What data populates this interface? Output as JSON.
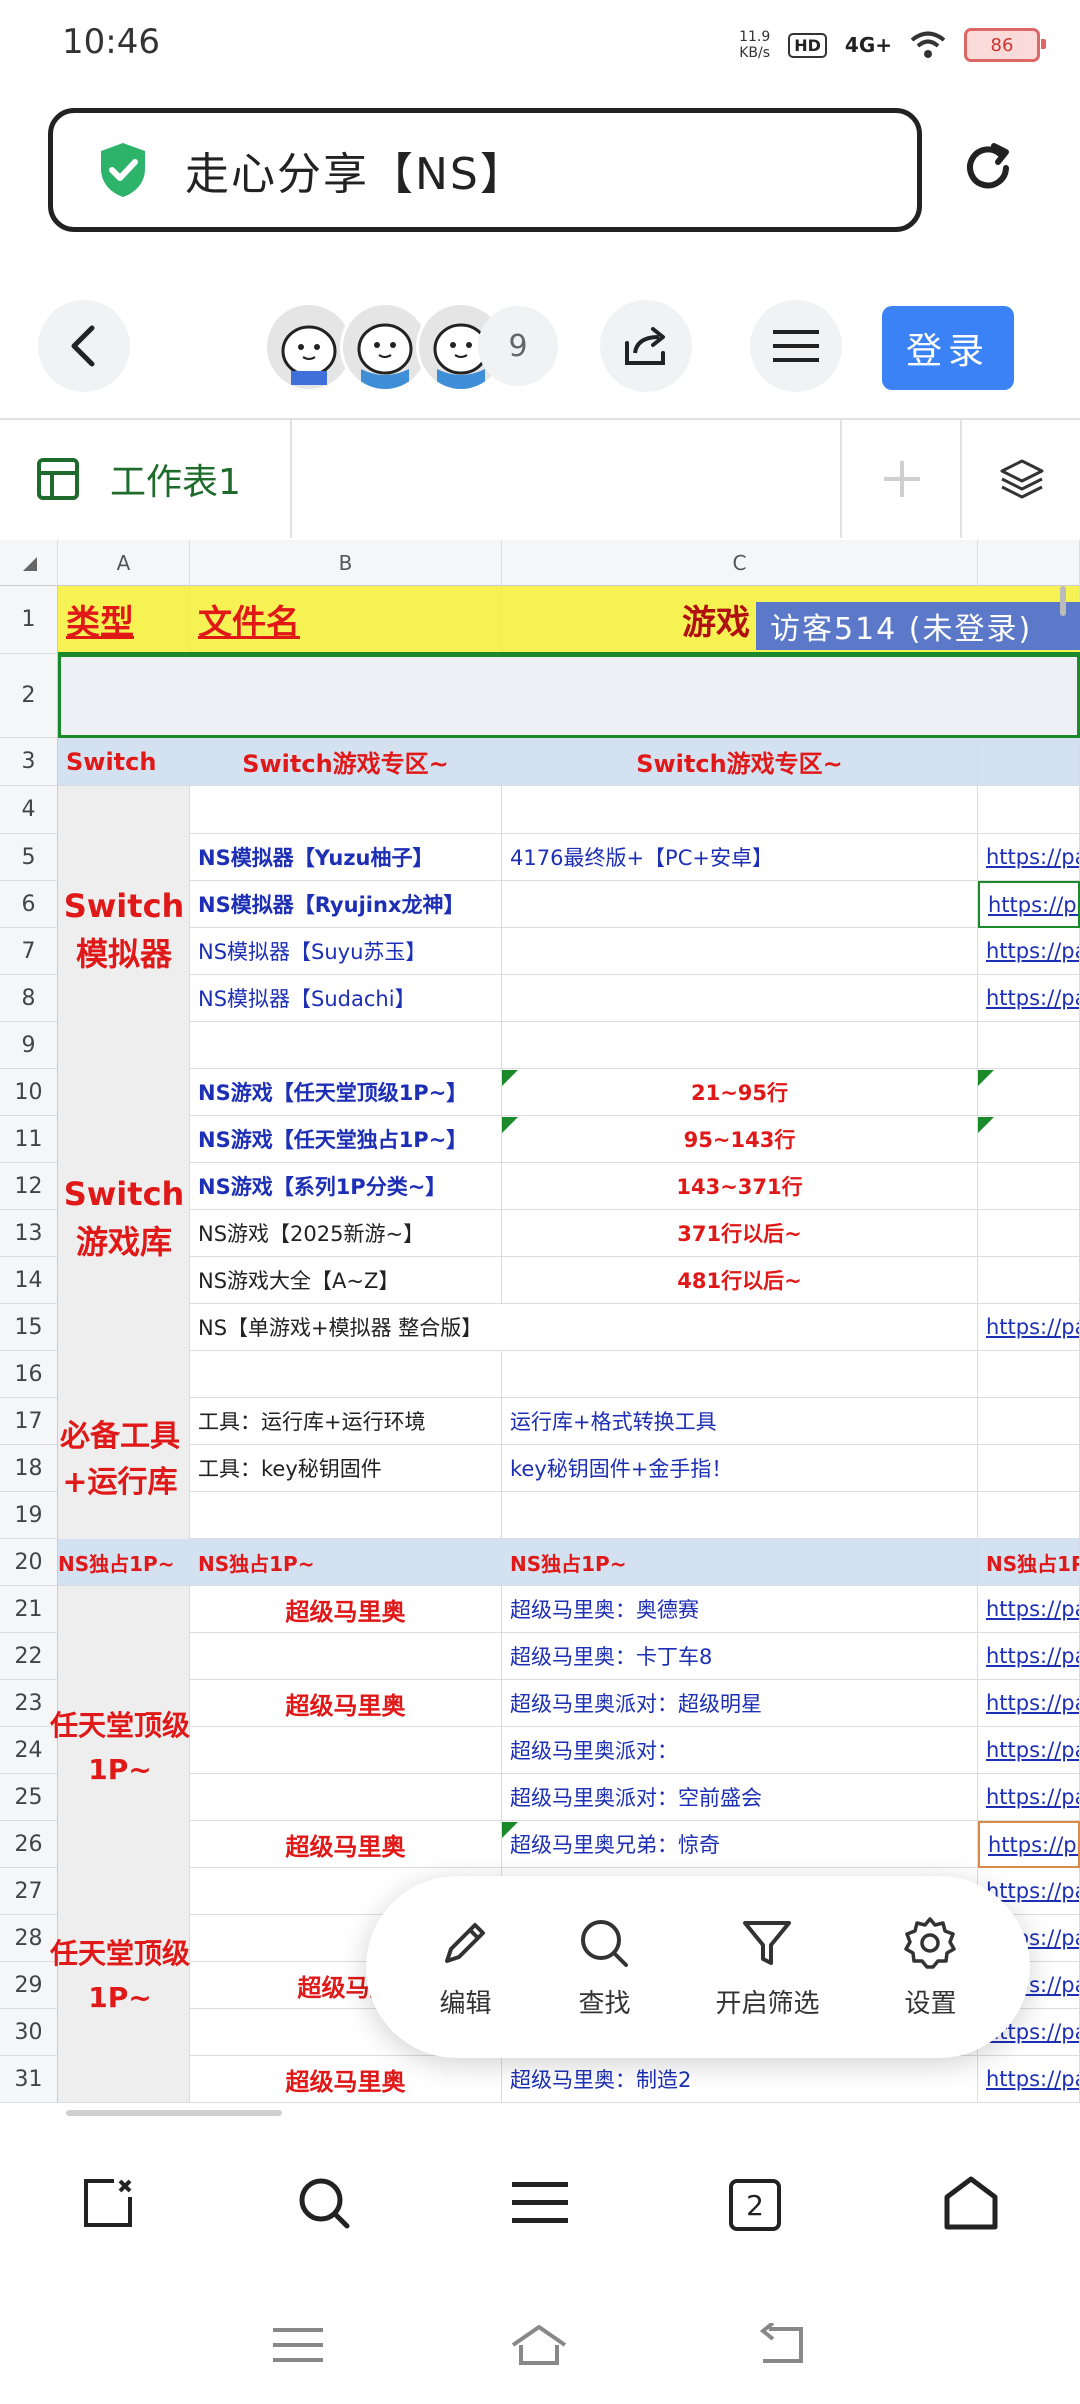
{
  "status": {
    "time": "10:46",
    "net_speed": "11.9",
    "net_unit": "KB/s",
    "hd": "HD",
    "signal": "4G+",
    "battery": "86"
  },
  "address": {
    "title": "走心分享【NS】"
  },
  "toolbar": {
    "collab_count": "9",
    "login_label": "登录"
  },
  "sheet": {
    "tab_name": "工作表1"
  },
  "columns": [
    "A",
    "B",
    "C"
  ],
  "row_numbers": [
    "1",
    "2",
    "3",
    "4",
    "5",
    "6",
    "7",
    "8",
    "9",
    "10",
    "11",
    "12",
    "13",
    "14",
    "15",
    "16",
    "17",
    "18",
    "19",
    "20",
    "21",
    "22",
    "23",
    "24",
    "25",
    "26",
    "27",
    "28",
    "29",
    "30",
    "31"
  ],
  "cells": {
    "r1": {
      "a": "类型",
      "b": "文件名",
      "c": "游戏",
      "visitor": "访客514 (未登录)"
    },
    "r3": {
      "a": "Switch",
      "b": "Switch游戏专区~",
      "c": "Switch游戏专区~"
    },
    "emulator_group": [
      "Switch",
      "模拟器"
    ],
    "r5": {
      "b": "NS模拟器【Yuzu柚子】",
      "c": "4176最终版+【PC+安卓】",
      "d": "https://pa"
    },
    "r6": {
      "b": "NS模拟器【Ryujinx龙神】",
      "d": "https://pa"
    },
    "r7": {
      "b": "NS模拟器【Suyu苏玉】",
      "d": "https://pa"
    },
    "r8": {
      "b": "NS模拟器【Sudachi】",
      "d": "https://pa"
    },
    "library_group": [
      "Switch",
      "游戏库"
    ],
    "r10": {
      "b": "NS游戏【任天堂顶级1P~】",
      "c": "21~95行"
    },
    "r11": {
      "b": "NS游戏【任天堂独占1P~】",
      "c": "95~143行"
    },
    "r12": {
      "b": "NS游戏【系列1P分类~】",
      "c": "143~371行"
    },
    "r13": {
      "b": "NS游戏【2025新游~】",
      "c": "371行以后~"
    },
    "r14": {
      "b": "NS游戏大全【A~Z】",
      "c": "481行以后~"
    },
    "r15": {
      "b": "NS【单游戏+模拟器 整合版】",
      "d": "https://pa"
    },
    "tools_group": [
      "必备工具",
      "+运行库"
    ],
    "r17": {
      "b": "工具：运行库+运行环境",
      "c": "运行库+格式转换工具"
    },
    "r18": {
      "b": "工具：key秘钥固件",
      "c": "key秘钥固件+金手指！"
    },
    "r20": {
      "a": "NS独占1P~",
      "b": "NS独占1P~",
      "c": "NS独占1P~",
      "d": "NS独占1P"
    },
    "top_group_1": [
      "任天堂顶级",
      "1P~"
    ],
    "top_group_2": [
      "任天堂顶级",
      "1P~"
    ],
    "r21": {
      "b": "超级马里奥",
      "c": "超级马里奥：奥德赛",
      "d": "https://pa"
    },
    "r22": {
      "c": "超级马里奥：卡丁车8",
      "d": "https://pa"
    },
    "r23": {
      "b": "超级马里奥",
      "c": "超级马里奥派对：超级明星",
      "d": "https://pa"
    },
    "r24": {
      "c": "超级马里奥派对：",
      "d": "https://pa"
    },
    "r25": {
      "c": "超级马里奥派对：空前盛会",
      "d": "https://pa"
    },
    "r26": {
      "b": "超级马里奥",
      "c": "超级马里奥兄弟：惊奇",
      "d": "https://pa"
    },
    "r27": {
      "d": "https://pa"
    },
    "r28": {
      "d": "https://pa"
    },
    "r29": {
      "b": "超级马里",
      "d": "https://pa"
    },
    "r30": {
      "d": "https://pa"
    },
    "r31": {
      "b": "超级马里奥",
      "c": "超级马里奥：制造2",
      "d": "https://pa"
    }
  },
  "fab": {
    "edit": "编辑",
    "find": "查找",
    "filter": "开启筛选",
    "settings": "设置"
  },
  "bottom_nav": {
    "tabs_count": "2"
  },
  "colors": {
    "accent": "#3b82f6",
    "header_yellow": "#f7f254",
    "section_blue": "#d4e1f0",
    "red_text": "#e01818",
    "blue_text": "#1c2fb5"
  }
}
